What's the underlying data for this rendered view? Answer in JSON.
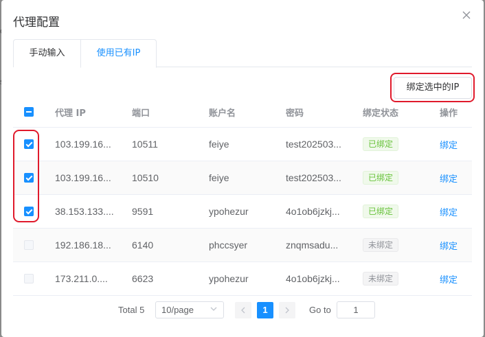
{
  "dialog": {
    "title": "代理配置"
  },
  "tabs": [
    {
      "label": "手动输入",
      "active": false
    },
    {
      "label": "使用已有IP",
      "active": true
    }
  ],
  "toolbar": {
    "bind_selected_label": "绑定选中的IP"
  },
  "table": {
    "columns": [
      "代理 IP",
      "端口",
      "账户名",
      "密码",
      "绑定状态",
      "操作"
    ],
    "rows": [
      {
        "ip": "103.199.16...",
        "port": "10511",
        "user": "feiye",
        "password": "test202503...",
        "status": "已绑定",
        "status_kind": "bound",
        "action": "绑定",
        "checked": true
      },
      {
        "ip": "103.199.16...",
        "port": "10510",
        "user": "feiye",
        "password": "test202503...",
        "status": "已绑定",
        "status_kind": "bound",
        "action": "绑定",
        "checked": true
      },
      {
        "ip": "38.153.133....",
        "port": "9591",
        "user": "ypohezur",
        "password": "4o1ob6jzkj...",
        "status": "已绑定",
        "status_kind": "bound",
        "action": "绑定",
        "checked": true
      },
      {
        "ip": "192.186.18...",
        "port": "6140",
        "user": "phccsyer",
        "password": "znqmsadu...",
        "status": "未绑定",
        "status_kind": "unbound",
        "action": "绑定",
        "checked": false
      },
      {
        "ip": "173.211.0....",
        "port": "6623",
        "user": "ypohezur",
        "password": "4o1ob6jzkj...",
        "status": "未绑定",
        "status_kind": "unbound",
        "action": "绑定",
        "checked": false
      }
    ]
  },
  "pagination": {
    "total_label": "Total 5",
    "page_size": "10/page",
    "current_page": "1",
    "goto_label": "Go to",
    "goto_value": "1"
  },
  "colors": {
    "accent": "#1890ff",
    "bound_tag": "#67c23a",
    "annotation_red": "#e0192b"
  }
}
